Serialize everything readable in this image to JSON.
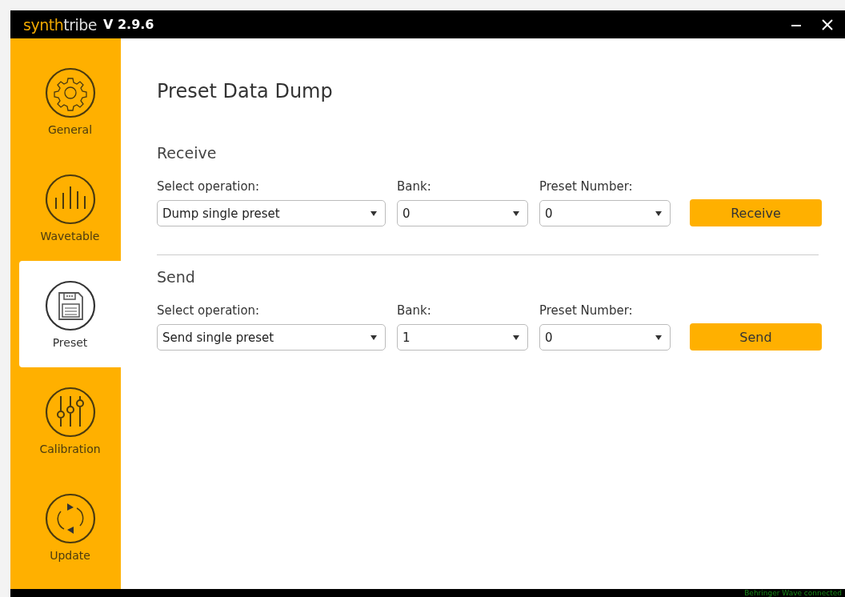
{
  "window": {
    "brand_prefix": "synth",
    "brand_suffix": "tribe",
    "version": "V 2.9.6"
  },
  "sidebar": {
    "items": [
      {
        "label": "General",
        "kind": "gear",
        "selected": false
      },
      {
        "label": "Wavetable",
        "kind": "bars",
        "selected": false
      },
      {
        "label": "Preset",
        "kind": "floppy",
        "selected": true
      },
      {
        "label": "Calibration",
        "kind": "sliders",
        "selected": false
      },
      {
        "label": "Update",
        "kind": "refresh",
        "selected": false
      }
    ]
  },
  "page_title": "Preset Data Dump",
  "sections": [
    {
      "title": "Receive",
      "fields": [
        {
          "label": "Select operation:",
          "value": "Dump single preset"
        },
        {
          "label": "Bank:",
          "value": "0"
        },
        {
          "label": "Preset Number:",
          "value": "0"
        }
      ],
      "button": "Receive"
    },
    {
      "title": "Send",
      "fields": [
        {
          "label": "Select operation:",
          "value": "Send single preset"
        },
        {
          "label": "Bank:",
          "value": "1"
        },
        {
          "label": "Preset Number:",
          "value": "0"
        }
      ],
      "button": "Send"
    }
  ],
  "status_bar": "Behringer Wave connected"
}
